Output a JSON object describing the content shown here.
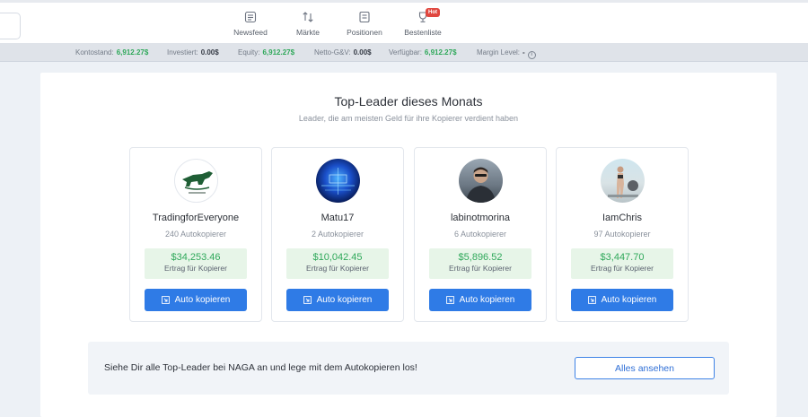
{
  "nav": {
    "items": [
      {
        "label": "Newsfeed",
        "icon": "newsfeed-icon"
      },
      {
        "label": "Märkte",
        "icon": "markets-icon"
      },
      {
        "label": "Positionen",
        "icon": "positions-icon"
      },
      {
        "label": "Bestenliste",
        "icon": "leaderboard-icon",
        "badge": "Hot"
      }
    ]
  },
  "stats": [
    {
      "label": "Kontostand:",
      "value": "6,912.27$",
      "color": "#2fa85a"
    },
    {
      "label": "Investiert:",
      "value": "0.00$",
      "color": "#343a44"
    },
    {
      "label": "Equity:",
      "value": "6,912.27$",
      "color": "#2fa85a"
    },
    {
      "label": "Netto-G&V:",
      "value": "0.00$",
      "color": "#343a44"
    },
    {
      "label": "Verfügbar:",
      "value": "6,912.27$",
      "color": "#2fa85a"
    },
    {
      "label": "Margin Level:",
      "value": "-",
      "color": "#343a44"
    }
  ],
  "leaders": {
    "title": "Top-Leader dieses Monats",
    "subtitle": "Leader, die am meisten Geld für ihre Kopierer verdient haben",
    "cards": [
      {
        "name": "TradingforEveryone",
        "copiers": "240 Autokopierer",
        "profit": "$34,253.46",
        "profit_label": "Ertrag für Kopierer",
        "button": "Auto kopieren"
      },
      {
        "name": "Matu17",
        "copiers": "2 Autokopierer",
        "profit": "$10,042.45",
        "profit_label": "Ertrag für Kopierer",
        "button": "Auto kopieren"
      },
      {
        "name": "labinotmorina",
        "copiers": "6 Autokopierer",
        "profit": "$5,896.52",
        "profit_label": "Ertrag für Kopierer",
        "button": "Auto kopieren"
      },
      {
        "name": "IamChris",
        "copiers": "97 Autokopierer",
        "profit": "$3,447.70",
        "profit_label": "Ertrag für Kopierer",
        "button": "Auto kopieren"
      }
    ]
  },
  "banner": {
    "text": "Siehe Dir alle Top-Leader bei NAGA an und lege mit dem Autokopieren los!",
    "button": "Alles ansehen"
  },
  "colors": {
    "accent": "#2f7be6",
    "profit": "#2fa85a",
    "profit_bg": "#e7f5e8",
    "hot_badge": "#e0473f"
  }
}
